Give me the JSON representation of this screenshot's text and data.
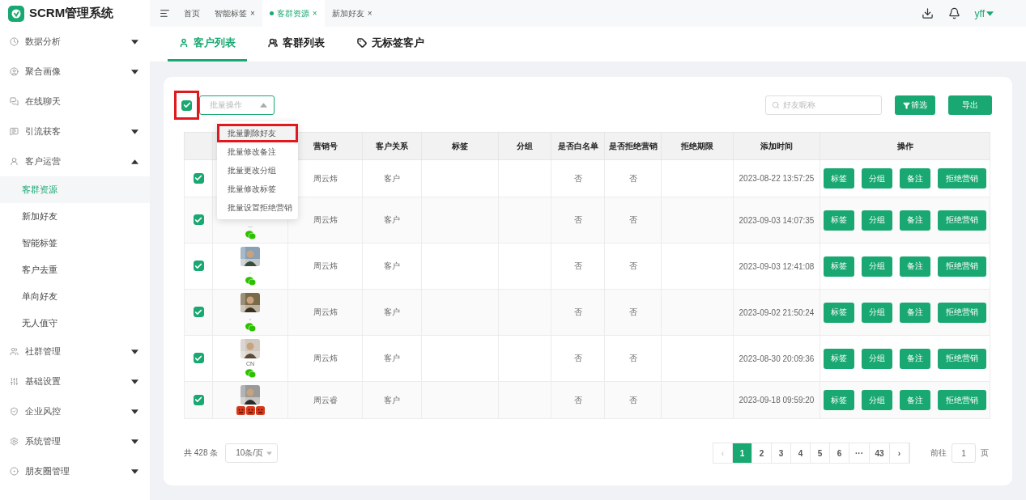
{
  "brand": {
    "name": "SCRM管理系统"
  },
  "sidebar": {
    "items": [
      {
        "label": "数据分析",
        "expanded": false
      },
      {
        "label": "聚合画像",
        "expanded": false
      },
      {
        "label": "在线聊天"
      },
      {
        "label": "引流获客",
        "expanded": false
      },
      {
        "label": "客户运营",
        "expanded": true,
        "children": [
          {
            "label": "客群资源",
            "selected": true
          },
          {
            "label": "新加好友",
            "selected": false
          },
          {
            "label": "智能标签",
            "selected": false
          },
          {
            "label": "客户去重",
            "selected": false
          },
          {
            "label": "单向好友",
            "selected": false
          },
          {
            "label": "无人值守",
            "selected": false
          }
        ]
      },
      {
        "label": "社群管理",
        "expanded": false
      },
      {
        "label": "基础设置",
        "expanded": false
      },
      {
        "label": "企业风控",
        "expanded": false
      },
      {
        "label": "系统管理",
        "expanded": false
      },
      {
        "label": "朋友圈管理",
        "expanded": false
      }
    ]
  },
  "tabs": [
    {
      "label": "首页",
      "selected": false,
      "closable": false
    },
    {
      "label": "智能标签",
      "selected": false,
      "closable": true
    },
    {
      "label": "客群资源",
      "selected": true,
      "closable": true
    },
    {
      "label": "新加好友",
      "selected": false,
      "closable": true
    }
  ],
  "close_glyph": "×",
  "user": {
    "name": "yff"
  },
  "subtabs": [
    {
      "label": "客户列表",
      "selected": true
    },
    {
      "label": "客群列表",
      "selected": false
    },
    {
      "label": "无标签客户",
      "selected": false
    }
  ],
  "toolbar": {
    "select_all": {
      "checked": true,
      "highlighted": true
    },
    "batch": {
      "placeholder": "批量操作",
      "open": true,
      "options": [
        {
          "label": "批量删除好友",
          "highlighted": true
        },
        {
          "label": "批量修改备注",
          "highlighted": false
        },
        {
          "label": "批量更改分组",
          "highlighted": false
        },
        {
          "label": "批量修改标签",
          "highlighted": false
        },
        {
          "label": "批量设置拒绝营销",
          "highlighted": false
        }
      ]
    },
    "search": {
      "placeholder": "好友昵称"
    },
    "filter_button": "筛选",
    "export_button": "导出"
  },
  "table": {
    "columns": [
      {
        "kind": "select"
      },
      {
        "kind": "avatar"
      },
      {
        "kind": "text",
        "label": "营销号"
      },
      {
        "kind": "text",
        "label": "客户关系"
      },
      {
        "kind": "text",
        "label": "标签"
      },
      {
        "kind": "text",
        "label": "分组"
      },
      {
        "kind": "text",
        "label": "是否白名单"
      },
      {
        "kind": "text",
        "label": "是否拒绝营销"
      },
      {
        "kind": "text",
        "label": "拒绝期限"
      },
      {
        "kind": "text",
        "label": "添加时间"
      },
      {
        "kind": "actions",
        "label": "操作"
      }
    ],
    "rows": [
      {
        "checked": true,
        "avatar": false,
        "kind": "plain",
        "marketer": "周云炜",
        "relation": "客户",
        "whitelist": "否",
        "refuse": "否",
        "time": "2023-08-22 13:57:25",
        "actions": [
          "标签",
          "分组",
          "备注",
          "拒绝营销"
        ]
      },
      {
        "checked": true,
        "avatar": false,
        "nickname": "...",
        "kind": "wechat",
        "marketer": "周云炜",
        "relation": "客户",
        "whitelist": "否",
        "refuse": "否",
        "time": "2023-09-03 14:07:35",
        "actions": [
          "标签",
          "分组",
          "备注",
          "拒绝营销"
        ]
      },
      {
        "checked": true,
        "avatar": true,
        "nickname": ".",
        "kind": "wechat",
        "marketer": "周云炜",
        "relation": "客户",
        "whitelist": "否",
        "refuse": "否",
        "time": "2023-09-03 12:41:08",
        "actions": [
          "标签",
          "分组",
          "备注",
          "拒绝营销"
        ]
      },
      {
        "checked": true,
        "avatar": true,
        "nickname": ",",
        "kind": "wechat",
        "marketer": "周云炜",
        "relation": "客户",
        "whitelist": "否",
        "refuse": "否",
        "time": "2023-09-02 21:50:24",
        "actions": [
          "标签",
          "分组",
          "备注",
          "拒绝营销"
        ]
      },
      {
        "checked": true,
        "avatar": true,
        "nickname": "CN",
        "kind": "wechat",
        "marketer": "周云炜",
        "relation": "客户",
        "whitelist": "否",
        "refuse": "否",
        "time": "2023-08-30 20:09:36",
        "actions": [
          "标签",
          "分组",
          "备注",
          "拒绝营销"
        ]
      },
      {
        "checked": true,
        "avatar": true,
        "kind": "emoji",
        "marketer": "周云睿",
        "relation": "客户",
        "whitelist": "否",
        "refuse": "否",
        "time": "2023-09-18 09:59:20",
        "actions": [
          "标签",
          "分组",
          "备注",
          "拒绝营销"
        ]
      }
    ]
  },
  "pagination": {
    "total": "共 428 条",
    "page_size": "10条/页",
    "prev": "‹",
    "next": "›",
    "pages": [
      {
        "label": "1",
        "selected": true
      },
      {
        "label": "2",
        "selected": false
      },
      {
        "label": "3",
        "selected": false
      },
      {
        "label": "4",
        "selected": false
      },
      {
        "label": "5",
        "selected": false
      },
      {
        "label": "6",
        "selected": false
      },
      {
        "label": "···",
        "selected": false
      },
      {
        "label": "43",
        "selected": false
      }
    ],
    "goto_label": "前往",
    "goto_value": "1",
    "goto_unit": "页"
  }
}
